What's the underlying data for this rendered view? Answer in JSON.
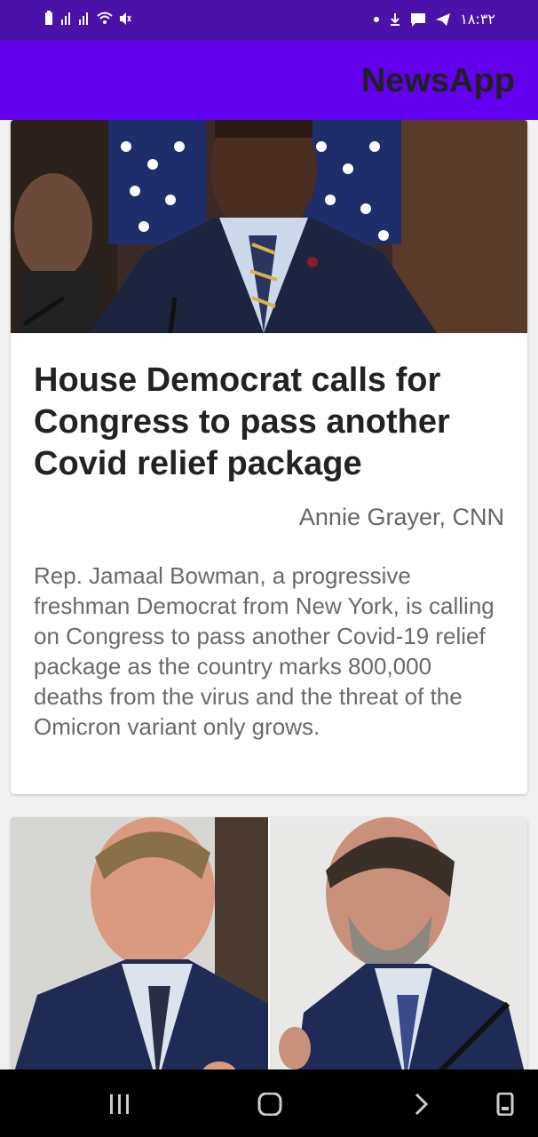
{
  "status_bar": {
    "time": "١٨:٣٢",
    "icons": [
      "battery-icon",
      "signal-icon",
      "signal-icon",
      "wifi-icon",
      "mute-icon",
      "dot-icon",
      "download-icon",
      "message-icon",
      "telegram-icon"
    ]
  },
  "app_bar": {
    "title": "NewsApp"
  },
  "articles": [
    {
      "image": "photo of man in suit speaking at podium with US flags",
      "title": "House Democrat calls for Congress to pass another Covid relief package",
      "author": "Annie Grayer, CNN",
      "description": "Rep. Jamaal Bowman, a progressive freshman Democrat from New York, is calling on Congress to pass another Covid-19 relief package as the country marks 800,000 deaths from the virus and the threat of the Omicron variant only grows."
    },
    {
      "image": "two photos side by side of men in suits speaking"
    }
  ],
  "nav_bar": {
    "buttons": [
      "recent-apps-icon",
      "home-icon",
      "back-icon",
      "screenshot-icon"
    ]
  },
  "colors": {
    "status_bar": "#4a12a8",
    "app_bar": "#6200ee",
    "title": "#202020"
  }
}
